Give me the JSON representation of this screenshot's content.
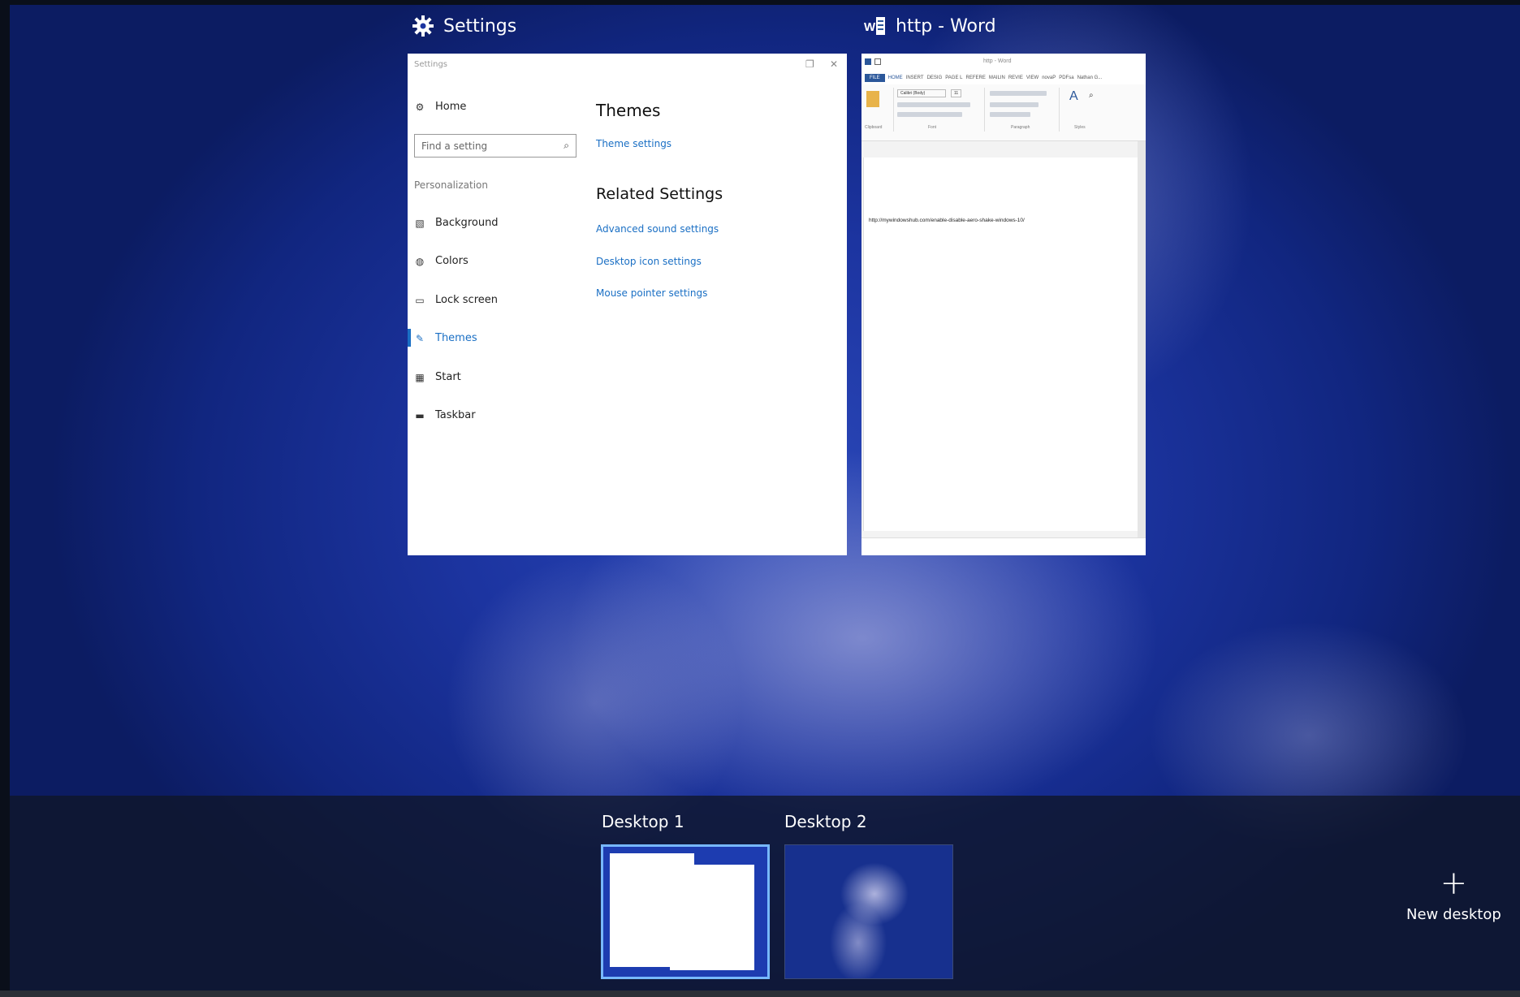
{
  "settings_caption": {
    "title": "Settings",
    "icon": "gear-icon"
  },
  "word_caption": {
    "title": "http - Word",
    "icon": "word-icon"
  },
  "settings_window": {
    "title": "Settings",
    "controls": {
      "restore": "❐",
      "close": "✕"
    },
    "home_label": "Home",
    "search": {
      "placeholder": "Find a setting",
      "icon": "search-icon"
    },
    "section_label": "Personalization",
    "nav_items": [
      {
        "label": "Background",
        "icon": "picture-icon"
      },
      {
        "label": "Colors",
        "icon": "palette-icon"
      },
      {
        "label": "Lock screen",
        "icon": "monitor-icon"
      },
      {
        "label": "Themes",
        "icon": "brush-icon",
        "active": true
      },
      {
        "label": "Start",
        "icon": "start-icon"
      },
      {
        "label": "Taskbar",
        "icon": "taskbar-icon"
      }
    ],
    "content": {
      "heading": "Themes",
      "theme_link": "Theme settings",
      "related_heading": "Related Settings",
      "related_links": [
        "Advanced sound settings",
        "Desktop icon settings",
        "Mouse pointer settings"
      ]
    }
  },
  "word_window": {
    "title": "http - Word",
    "ribbon_tabs": [
      "FILE",
      "HOME",
      "INSERT",
      "DESIG",
      "PAGE L",
      "REFERE",
      "MAILIN",
      "REVIE",
      "VIEW",
      "novaP",
      "PDFsa",
      "Nathan G..."
    ],
    "ribbon_groups": [
      "Clipboard",
      "Font",
      "Paragraph",
      "Styles"
    ],
    "font_name": "Calibri (Body)",
    "font_size": "11",
    "document_text": "http://mywindowshub.com/enable-disable-aero-shake-windows-10/"
  },
  "desktops": [
    {
      "label": "Desktop 1",
      "selected": true
    },
    {
      "label": "Desktop 2",
      "selected": false
    }
  ],
  "new_desktop": {
    "label": "New desktop",
    "icon": "plus-icon"
  },
  "colors": {
    "accent": "#1a6fc4",
    "selection": "#77b8ff",
    "word_blue": "#2b579a"
  }
}
